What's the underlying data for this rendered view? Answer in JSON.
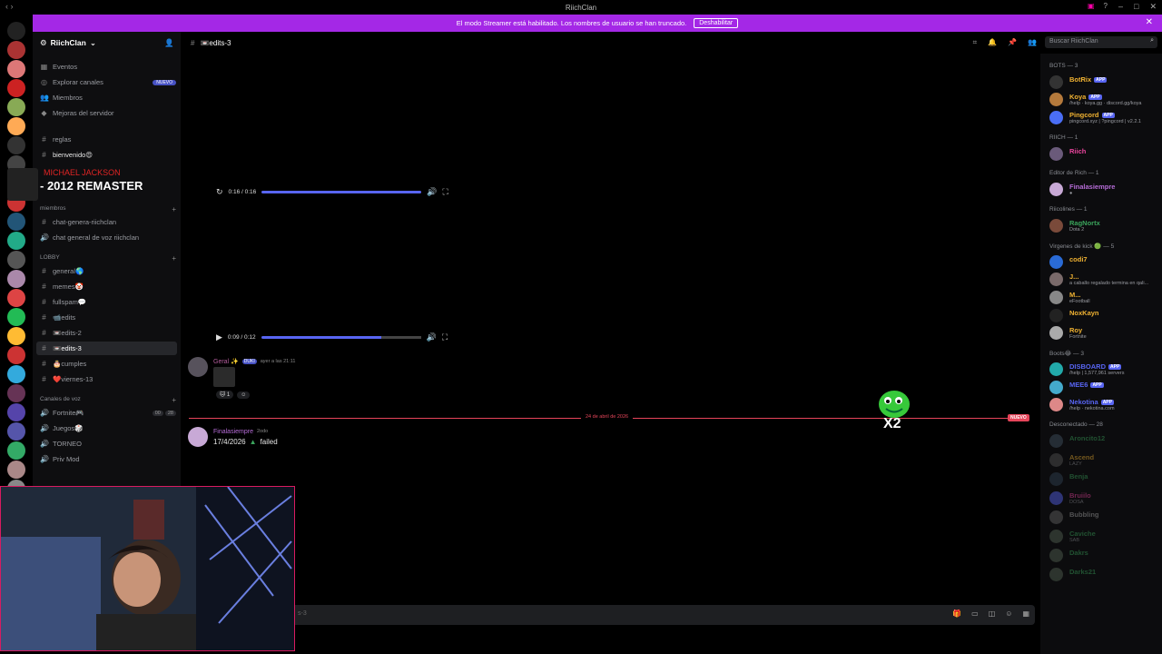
{
  "window": {
    "title": "RiichClan"
  },
  "banner": {
    "text": "El modo Streamer está habilitado. Los nombres de usuario se han truncado.",
    "button": "Deshabilitar"
  },
  "server": {
    "name": "RiichClan"
  },
  "sidebar": {
    "top_items": [
      {
        "label": "Eventos",
        "icon": "calendar-icon"
      },
      {
        "label": "Explorar canales",
        "icon": "compass-icon",
        "badge": "NUEVO"
      },
      {
        "label": "Miembros",
        "icon": "members-icon"
      },
      {
        "label": "Mejoras del servidor",
        "icon": "boost-icon"
      }
    ],
    "channels_a": [
      {
        "label": "reglas"
      },
      {
        "label": "bienvenido😍"
      }
    ],
    "cat_miembros": "miembros",
    "channels_b": [
      {
        "label": "chat-genera-riichclan",
        "icon": "hash-icon"
      },
      {
        "label": "chat general de voz riichclan",
        "icon": "speaker-icon"
      }
    ],
    "cat_lobby": "LOBBY",
    "channels_lobby": [
      {
        "label": "general🌎"
      },
      {
        "label": "memes🤡"
      },
      {
        "label": "fullspam💬"
      },
      {
        "label": "📹edits"
      },
      {
        "label": "📼edits-2"
      },
      {
        "label": "📼edits-3"
      },
      {
        "label": "🎂cumples"
      },
      {
        "label": "❤️viernes-13"
      }
    ],
    "cat_voz": "Canales de voz",
    "voice_channels": [
      {
        "label": "Fortnite🎮",
        "tags": [
          "00",
          "28"
        ]
      },
      {
        "label": "Juegos🎲"
      },
      {
        "label": "TORNEO"
      },
      {
        "label": "Priv Mod"
      }
    ]
  },
  "now_playing": {
    "artist": "MICHAEL JACKSON",
    "title": "- 2012 REMASTER"
  },
  "channel": {
    "name": "📼edits-3"
  },
  "search": {
    "placeholder": "Buscar RiichClan"
  },
  "players": [
    {
      "time": "0:16 / 0:16",
      "progress": 1.0
    },
    {
      "time": "0:09 / 0:12",
      "progress": 0.75
    }
  ],
  "messages": [
    {
      "author": "Geral ✨",
      "tag": "DUKI",
      "time": "ayer a las 21:11",
      "reactions": [
        "1"
      ]
    },
    {
      "author": "Finalasiempre",
      "tag": "2odo",
      "text": "17/4/2026",
      "text2": "failed"
    }
  ],
  "divider": {
    "date": "24 de abril de 2026",
    "label": "NUEVO"
  },
  "sticker": {
    "label": "X2"
  },
  "input": {
    "placeholder": "s-3"
  },
  "members": {
    "groups": [
      {
        "title": "BOTS — 3",
        "items": [
          {
            "name": "BotRix",
            "app": "APP",
            "color": "#f0b232",
            "avatar": "#333"
          },
          {
            "name": "Koya",
            "app": "APP",
            "status": "/help · koya.gg · discord.gg/koya",
            "color": "#f0b232",
            "avatar": "#b57a3c"
          },
          {
            "name": "Pingcord",
            "app": "APP",
            "status": "pingcord.xyz | ?pingcord | v2.2.1",
            "color": "#f0b232",
            "avatar": "#4a6ef5"
          }
        ]
      },
      {
        "title": "RIICH — 1",
        "items": [
          {
            "name": "Riich",
            "color": "#eb459e",
            "avatar": "#6a5a7a"
          }
        ]
      },
      {
        "title": "Editor de Rich — 1",
        "items": [
          {
            "name": "Finalasiempre",
            "color": "#b56cd6",
            "avatar": "#c8a9d6",
            "status": "●"
          }
        ]
      },
      {
        "title": "Riicolines — 1",
        "items": [
          {
            "name": "RagNortx",
            "color": "#3ba55c",
            "avatar": "#7a4a3a",
            "status": "Dota 2"
          }
        ]
      },
      {
        "title": "Virgenes de kick 🟢 — 5",
        "items": [
          {
            "name": "codi7",
            "color": "#f0b232",
            "avatar": "#2a6bd6"
          },
          {
            "name": "J...",
            "color": "#f0b232",
            "avatar": "#7a6a6a",
            "status": "a caballo regalado termina en qali..."
          },
          {
            "name": "M...",
            "color": "#f0b232",
            "avatar": "#888",
            "status": "eFootball"
          },
          {
            "name": "NoxKayn",
            "color": "#f0b232",
            "avatar": "#222"
          },
          {
            "name": "Roy",
            "color": "#f0b232",
            "avatar": "#aaa",
            "status": "Fortnite"
          }
        ]
      },
      {
        "title": "Boots😂 — 3",
        "items": [
          {
            "name": "DISBOARD",
            "app": "APP",
            "status": "/help | 1,577,961 servers",
            "color": "#5865f2",
            "avatar": "#2aa"
          },
          {
            "name": "MEE6",
            "app": "APP",
            "color": "#5865f2",
            "avatar": "#4ac"
          },
          {
            "name": "Nekotina",
            "app": "APP",
            "status": "/help · nekotina.com",
            "color": "#5865f2",
            "avatar": "#d88"
          }
        ]
      },
      {
        "title": "Desconectado — 28",
        "items": [
          {
            "name": "Aroncito12",
            "color": "#3ba55c",
            "avatar": "#456"
          },
          {
            "name": "Ascend",
            "color": "#f0b232",
            "avatar": "#555",
            "status": "LAZY"
          },
          {
            "name": "Benja",
            "color": "#3ba55c",
            "avatar": "#345"
          },
          {
            "name": "Bruiilo",
            "color": "#eb459e",
            "avatar": "#5865f2",
            "status": "DOSA"
          },
          {
            "name": "Bubbling",
            "color": "#aaa",
            "avatar": "#666"
          },
          {
            "name": "Caviche",
            "color": "#3ba55c",
            "avatar": "#565",
            "status": "SAB"
          },
          {
            "name": "Dakrs",
            "color": "#3ba55c",
            "avatar": "#565"
          },
          {
            "name": "Darks21",
            "color": "#3ba55c",
            "avatar": "#565"
          }
        ]
      }
    ]
  },
  "colors": {
    "accent": "#5865f2",
    "banner": "#a428e6",
    "divider": "#e6455a"
  }
}
